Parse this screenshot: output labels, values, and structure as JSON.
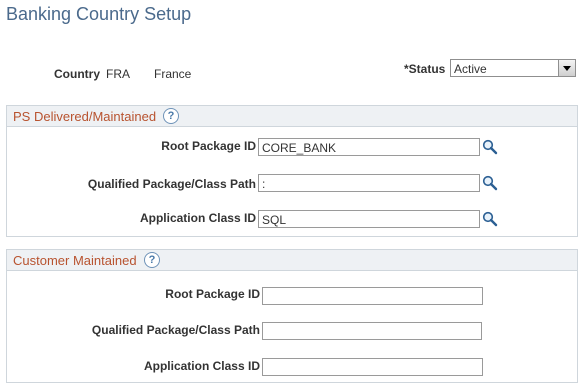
{
  "page": {
    "title": "Banking Country Setup"
  },
  "country": {
    "label": "Country",
    "code": "FRA",
    "name": "France"
  },
  "status": {
    "label": "*Status",
    "value": "Active"
  },
  "delivered": {
    "title": "PS Delivered/Maintained",
    "help_icon": "help-icon",
    "fields": [
      {
        "label": "Root Package ID",
        "value": "CORE_BANK"
      },
      {
        "label": "Qualified Package/Class Path",
        "value": ":"
      },
      {
        "label": "Application Class ID",
        "value": "SQL"
      }
    ]
  },
  "customer": {
    "title": "Customer Maintained",
    "help_icon": "help-icon",
    "fields": [
      {
        "label": "Root Package ID",
        "value": ""
      },
      {
        "label": "Qualified Package/Class Path",
        "value": ""
      },
      {
        "label": "Application Class ID",
        "value": ""
      }
    ]
  }
}
